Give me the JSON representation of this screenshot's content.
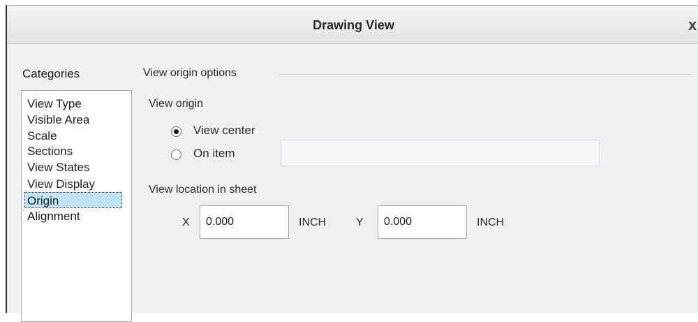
{
  "window": {
    "title": "Drawing View",
    "close_glyph": "x"
  },
  "categories": {
    "label": "Categories",
    "items": [
      "View Type",
      "Visible Area",
      "Scale",
      "Sections",
      "View States",
      "View Display",
      "Origin",
      "Alignment"
    ],
    "selected": "Origin"
  },
  "origin_options": {
    "group_title": "View origin options",
    "view_origin_label": "View origin",
    "radio_view_center": "View center",
    "radio_on_item": "On item",
    "on_item_value": "",
    "location_label": "View location in sheet",
    "x_label": "X",
    "x_value": "0.000",
    "x_unit": "INCH",
    "y_label": "Y",
    "y_value": "0.000",
    "y_unit": "INCH"
  }
}
